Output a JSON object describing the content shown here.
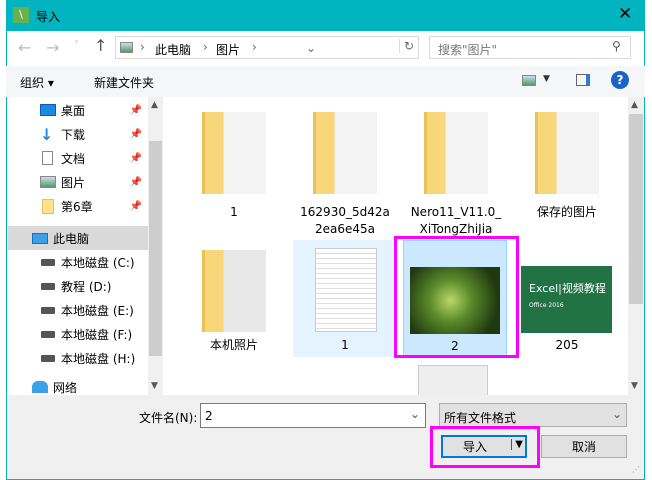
{
  "window": {
    "title": "导入"
  },
  "nav": {
    "path": [
      "此电脑",
      "图片"
    ],
    "search_placeholder": "搜索\"图片\""
  },
  "toolbar": {
    "organize": "组织 ▾",
    "new_folder": "新建文件夹"
  },
  "sidebar": {
    "quick": [
      {
        "label": "桌面"
      },
      {
        "label": "下载"
      },
      {
        "label": "文档"
      },
      {
        "label": "图片"
      },
      {
        "label": "第6章"
      }
    ],
    "pc": "此电脑",
    "drives": [
      {
        "label": "本地磁盘 (C:)"
      },
      {
        "label": "教程 (D:)"
      },
      {
        "label": "本地磁盘 (E:)"
      },
      {
        "label": "本地磁盘 (F:)"
      },
      {
        "label": "本地磁盘 (H:)"
      }
    ],
    "network": "网络"
  },
  "files": [
    {
      "name": "1",
      "type": "folder"
    },
    {
      "name": "162930_5d42a2ea6e45a",
      "type": "folder"
    },
    {
      "name": "Nero11_V11.0_XiTongZhiJia",
      "type": "folder"
    },
    {
      "name": "保存的图片",
      "type": "folder"
    },
    {
      "name": "本机照片",
      "type": "folder"
    },
    {
      "name": "1",
      "type": "text"
    },
    {
      "name": "2",
      "type": "image",
      "selected": true
    },
    {
      "name": "205",
      "type": "image",
      "thumb_text": "Excel|视频教程",
      "thumb_sub": "Office 2016"
    }
  ],
  "footer": {
    "filename_label": "文件名(N):",
    "filename_value": "2",
    "filter": "所有文件格式",
    "import": "导入",
    "cancel": "取消"
  },
  "colors": {
    "accent": "#00b4c0",
    "highlight": "#ff00ff",
    "selected": "#cce8ff"
  }
}
